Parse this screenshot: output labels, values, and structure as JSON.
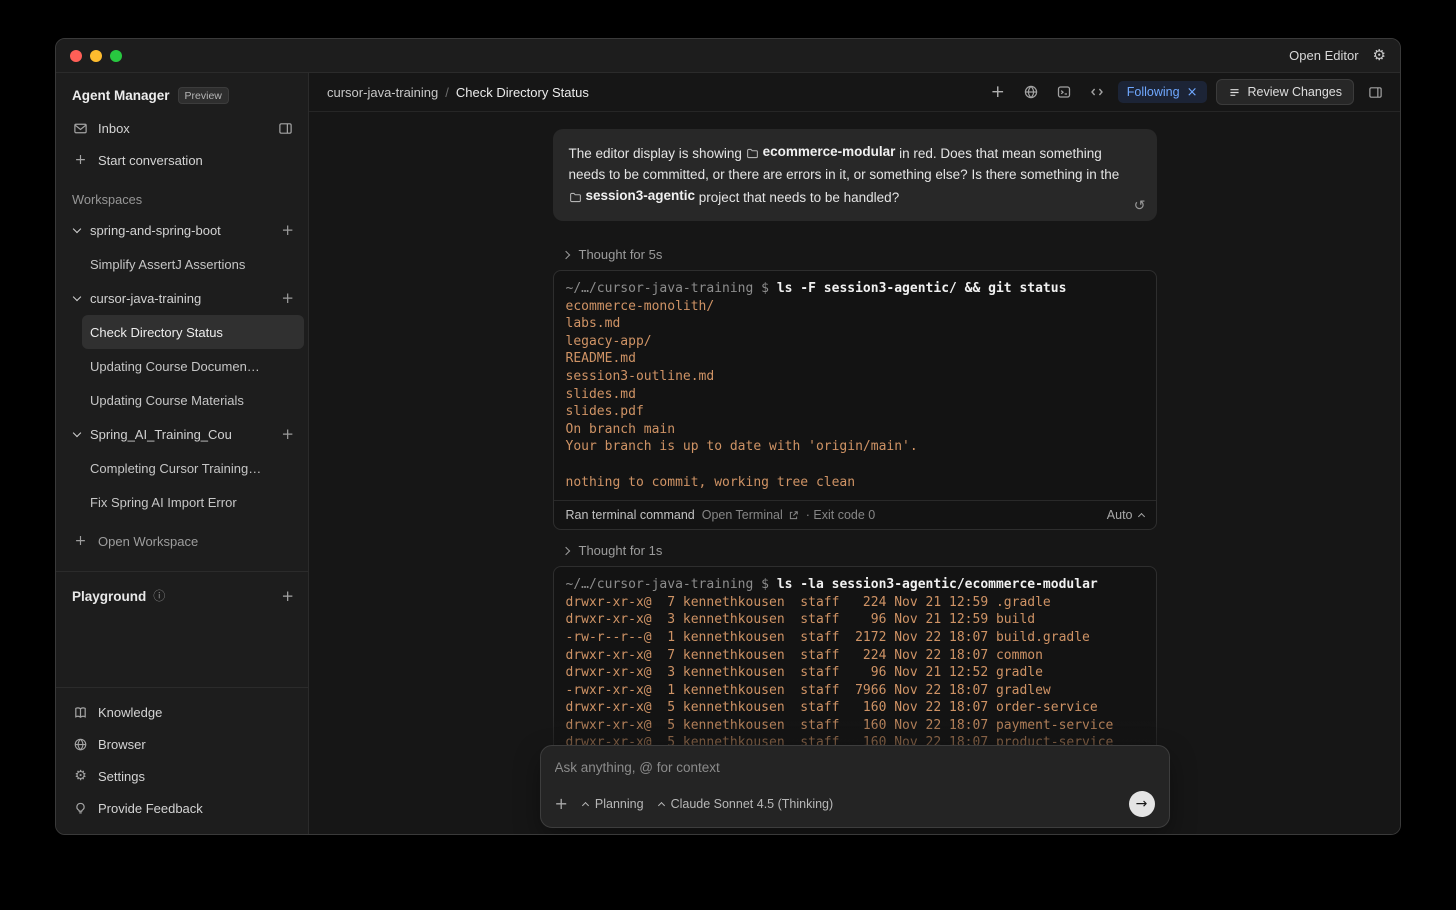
{
  "colors": {
    "accent_blue": "#6fa8ff",
    "terminal_output_orange": "#cf9365",
    "traffic_close": "#ff5f57",
    "traffic_minimize": "#febc2e",
    "traffic_zoom": "#28c840"
  },
  "glyphs": {
    "gear": "⚙",
    "plus": "+",
    "close": "×",
    "undo": "↺",
    "info": "ⓘ",
    "send": "→"
  },
  "titlebar": {
    "open_editor": "Open Editor"
  },
  "sidebar": {
    "title": "Agent Manager",
    "badge": "Preview",
    "inbox_label": "Inbox",
    "start_conversation_label": "Start conversation",
    "workspaces_label": "Workspaces",
    "workspaces": [
      {
        "name": "spring-and-spring-boot",
        "items": [
          {
            "label": "Simplify AssertJ Assertions",
            "selected": false
          }
        ]
      },
      {
        "name": "cursor-java-training",
        "items": [
          {
            "label": "Check Directory Status",
            "selected": true
          },
          {
            "label": "Updating Course Documen…",
            "selected": false
          },
          {
            "label": "Updating Course Materials",
            "selected": false
          }
        ]
      },
      {
        "name": "Spring_AI_Training_Cou",
        "items": [
          {
            "label": "Completing Cursor Training…",
            "selected": false
          },
          {
            "label": "Fix Spring AI Import Error",
            "selected": false
          }
        ]
      }
    ],
    "open_workspace_label": "Open Workspace",
    "playground_label": "Playground",
    "footer_items": [
      {
        "label": "Knowledge",
        "icon": "book"
      },
      {
        "label": "Browser",
        "icon": "globe"
      },
      {
        "label": "Settings",
        "icon": "gear"
      },
      {
        "label": "Provide Feedback",
        "icon": "bulb"
      }
    ]
  },
  "header": {
    "breadcrumb": {
      "workspace": "cursor-java-training",
      "separator": "/",
      "page": "Check Directory Status"
    },
    "following_label": "Following",
    "review_changes_label": "Review Changes"
  },
  "chat": {
    "user_message": {
      "segments": [
        {
          "type": "text",
          "text": "The editor display is showing "
        },
        {
          "type": "file",
          "text": "ecommerce-modular"
        },
        {
          "type": "text",
          "text": " in red. Does that mean something needs to be committed, or there are errors in it, or something else? Is there something in the "
        },
        {
          "type": "file",
          "text": "session3-agentic"
        },
        {
          "type": "text",
          "text": " project that needs to be handled?"
        }
      ]
    },
    "thought1": "Thought for 5s",
    "thought2": "Thought for 1s",
    "terminal1": {
      "prompt": "~/…/cursor-java-training $ ",
      "command": "ls -F session3-agentic/ && git status",
      "lines": [
        "ecommerce-monolith/",
        "labs.md",
        "legacy-app/",
        "README.md",
        "session3-outline.md",
        "slides.md",
        "slides.pdf",
        "On branch main",
        "Your branch is up to date with 'origin/main'.",
        "",
        "nothing to commit, working tree clean"
      ],
      "footer": {
        "ran": "Ran terminal command",
        "open_terminal": "Open Terminal",
        "exit": "· Exit code 0",
        "auto": "Auto"
      }
    },
    "terminal2": {
      "prompt": "~/…/cursor-java-training $ ",
      "command": "ls -la session3-agentic/ecommerce-modular",
      "lines": [
        "drwxr-xr-x@  7 kennethkousen  staff   224 Nov 21 12:59 .gradle",
        "drwxr-xr-x@  3 kennethkousen  staff    96 Nov 21 12:59 build",
        "-rw-r--r--@  1 kennethkousen  staff  2172 Nov 22 18:07 build.gradle",
        "drwxr-xr-x@  7 kennethkousen  staff   224 Nov 22 18:07 common",
        "drwxr-xr-x@  3 kennethkousen  staff    96 Nov 21 12:52 gradle",
        "-rwxr-xr-x@  1 kennethkousen  staff  7966 Nov 22 18:07 gradlew",
        "drwxr-xr-x@  5 kennethkousen  staff   160 Nov 22 18:07 order-service",
        "drwxr-xr-x@  5 kennethkousen  staff   160 Nov 22 18:07 payment-service",
        "drwxr-xr-x@  5 kennethkousen  staff   160 Nov 22 18:07 product-service"
      ]
    }
  },
  "composer": {
    "placeholder": "Ask anything, @ for context",
    "planning_label": "Planning",
    "model_label": "Claude Sonnet 4.5 (Thinking)"
  }
}
